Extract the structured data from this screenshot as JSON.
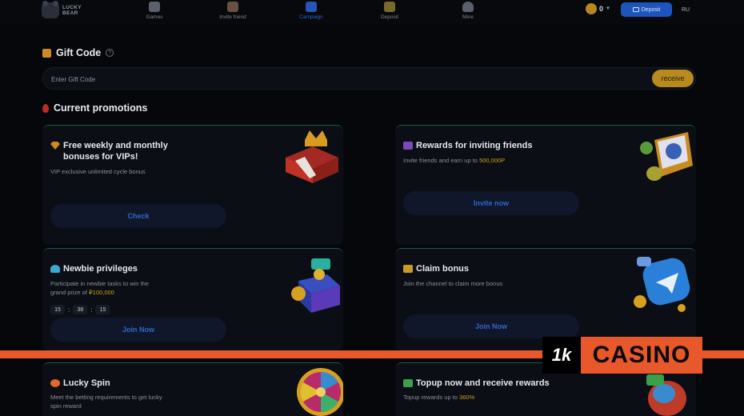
{
  "brand": {
    "logo_line1": "LUCKY",
    "logo_line2": "BEAR"
  },
  "nav": [
    {
      "label": "Games",
      "icon": "home-icon"
    },
    {
      "label": "Invite friend",
      "icon": "gift-icon"
    },
    {
      "label": "Campaign",
      "icon": "bookmark-icon",
      "active": true
    },
    {
      "label": "Deposit",
      "icon": "deposit-bag-icon"
    },
    {
      "label": "Mine",
      "icon": "user-icon"
    }
  ],
  "header": {
    "coin_value": "0",
    "deposit_label": "Deposit",
    "lang": "RU"
  },
  "gift": {
    "title": "Gift Code",
    "placeholder": "Enter Gift Code",
    "button": "receive"
  },
  "promotions_title": "Current promotions",
  "cards": {
    "vip": {
      "title_line1": "Free weekly and monthly",
      "title_line2": "bonuses for VIPs!",
      "desc": "VIP exclusive unlimited cycle bonus",
      "button": "Check"
    },
    "invite": {
      "title": "Rewards for inviting friends",
      "desc_prefix": "Invite friends and earn up to ",
      "desc_highlight": "500,000P",
      "button": "Invite now"
    },
    "newbie": {
      "title": "Newbie privileges",
      "desc_line1": "Participate in newbie tasks to win the",
      "desc_line2_prefix": "grand prize of ",
      "desc_highlight": "₽100,000",
      "timer": [
        "15",
        "38",
        "15"
      ],
      "button": "Join Now"
    },
    "claim": {
      "title": "Claim bonus",
      "desc": "Join the channel to claim more bonus",
      "button": "Join Now"
    },
    "spin": {
      "title": "Lucky Spin",
      "desc_line1": "Meet the betting requirements to get lucky",
      "desc_line2": "spin reward"
    },
    "topup": {
      "title": "Topup now and receive rewards",
      "desc_prefix": "Topup rewards up to ",
      "desc_highlight": "360%"
    }
  },
  "watermark": {
    "mark": "1k",
    "text": "CASINO"
  },
  "colors": {
    "accent_blue": "#1e55bd",
    "gold": "#b88a20",
    "watermark_orange": "#e8582a",
    "background": "#05070b"
  }
}
